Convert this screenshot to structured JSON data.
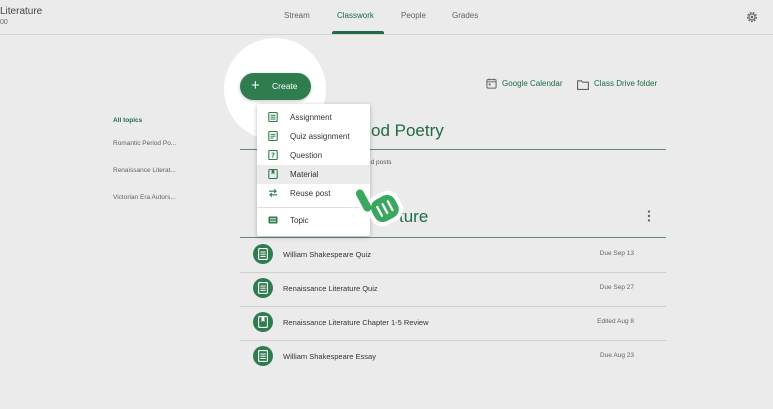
{
  "header": {
    "course_title": "Literature",
    "course_subtitle": "00",
    "tabs": [
      {
        "label": "Stream"
      },
      {
        "label": "Classwork"
      },
      {
        "label": "People"
      },
      {
        "label": "Grades"
      }
    ],
    "active_tab": "Classwork"
  },
  "create_button": {
    "label": "Create"
  },
  "links": {
    "calendar": "Google Calendar",
    "drive": "Class Drive folder"
  },
  "topics_sidebar": {
    "items": [
      {
        "label": "All topics",
        "active": true
      },
      {
        "label": "Romantic Period Po..."
      },
      {
        "label": "Renaissance Literat..."
      },
      {
        "label": "Victorian Era Autors..."
      }
    ]
  },
  "sections": {
    "first_title_visible": "od Poetry",
    "first_notice_visible": "ublished posts",
    "second_title_visible": "ture"
  },
  "items": [
    {
      "name": "William Shakespeare Quiz",
      "due": "Due Sep 13",
      "icon": "assignment-icon"
    },
    {
      "name": "Renaissance Literature Quiz",
      "due": "Due Sep 27",
      "icon": "assignment-icon"
    },
    {
      "name": "Renaissance Literature Chapter 1-5 Review",
      "due": "Edited Aug 8",
      "icon": "material-icon"
    },
    {
      "name": "William Shakespeare Essay",
      "due": "Due Aug 23",
      "icon": "assignment-icon"
    }
  ],
  "create_menu": {
    "items": [
      {
        "label": "Assignment",
        "icon": "assignment-icon"
      },
      {
        "label": "Quiz assignment",
        "icon": "quiz-icon"
      },
      {
        "label": "Question",
        "icon": "question-icon"
      },
      {
        "label": "Material",
        "icon": "material-icon",
        "highlighted": true
      },
      {
        "label": "Reuse post",
        "icon": "reuse-icon"
      },
      {
        "label": "Topic",
        "icon": "topic-icon"
      }
    ]
  },
  "colors": {
    "accent": "#2f7d4f",
    "accent_text": "#1e6b45",
    "background": "#ebebeb",
    "hand_cursor": "#3aa75e"
  }
}
